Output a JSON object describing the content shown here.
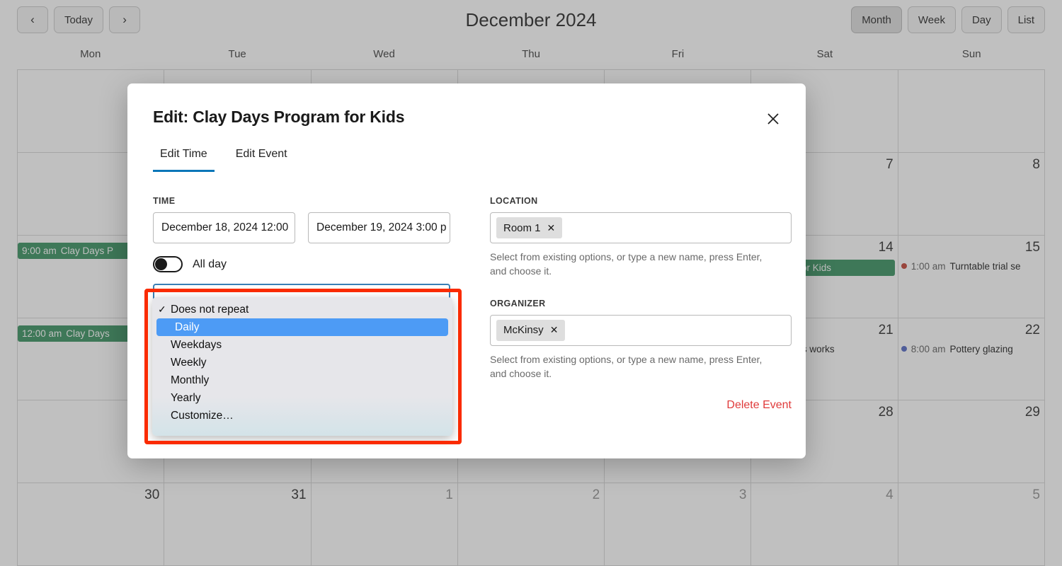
{
  "calendar": {
    "nav": {
      "prev_label": "‹",
      "today_label": "Today",
      "next_label": "›"
    },
    "title": "December 2024",
    "views": [
      {
        "label": "Month",
        "active": true
      },
      {
        "label": "Week",
        "active": false
      },
      {
        "label": "Day",
        "active": false
      },
      {
        "label": "List",
        "active": false
      }
    ],
    "day_headers": [
      "Mon",
      "Tue",
      "Wed",
      "Thu",
      "Fri",
      "Sat",
      "Sun"
    ],
    "weeks": [
      {
        "days": [
          {
            "num": "",
            "muted": false,
            "events": []
          },
          {
            "num": "",
            "muted": false,
            "events": []
          },
          {
            "num": "",
            "muted": false,
            "events": []
          },
          {
            "num": "",
            "muted": false,
            "events": []
          },
          {
            "num": "",
            "muted": false,
            "events": []
          },
          {
            "num": "",
            "muted": false,
            "events": []
          },
          {
            "num": "",
            "muted": false,
            "events": []
          }
        ]
      },
      {
        "days": [
          {
            "num": "",
            "muted": false,
            "events": []
          },
          {
            "num": "",
            "muted": false,
            "events": []
          },
          {
            "num": "",
            "muted": false,
            "events": []
          },
          {
            "num": "",
            "muted": false,
            "events": []
          },
          {
            "num": "",
            "muted": false,
            "events": []
          },
          {
            "num": "7",
            "muted": false,
            "events": []
          },
          {
            "num": "8",
            "muted": false,
            "events": []
          }
        ]
      },
      {
        "days": [
          {
            "num": "",
            "muted": false,
            "events": [
              {
                "style": "block",
                "time": "9:00 am",
                "name": "Clay Days P"
              }
            ]
          },
          {
            "num": "",
            "muted": false,
            "events": []
          },
          {
            "num": "",
            "muted": false,
            "events": []
          },
          {
            "num": "",
            "muted": false,
            "events": []
          },
          {
            "num": "",
            "muted": false,
            "events": []
          },
          {
            "num": "14",
            "muted": false,
            "events": [
              {
                "style": "bleed",
                "time": "",
                "name": "Clay Days Program for Kids"
              }
            ]
          },
          {
            "num": "15",
            "muted": false,
            "events": [
              {
                "style": "dot",
                "dot_color": "#c0392b",
                "time": "1:00 am",
                "name": "Turntable trial se"
              }
            ]
          }
        ]
      },
      {
        "days": [
          {
            "num": "",
            "muted": false,
            "events": [
              {
                "style": "block",
                "time": "12:00 am",
                "name": "Clay Days "
              }
            ]
          },
          {
            "num": "",
            "muted": false,
            "events": []
          },
          {
            "num": "",
            "muted": false,
            "events": []
          },
          {
            "num": "",
            "muted": false,
            "events": []
          },
          {
            "num": "",
            "muted": false,
            "events": []
          },
          {
            "num": "21",
            "muted": false,
            "events": [
              {
                "style": "plain",
                "time": "m",
                "name": "Ceramics works"
              }
            ]
          },
          {
            "num": "22",
            "muted": false,
            "events": [
              {
                "style": "dot",
                "dot_color": "#4a5fc1",
                "time": "8:00 am",
                "name": "Pottery glazing"
              }
            ]
          }
        ]
      },
      {
        "days": [
          {
            "num": "",
            "muted": false,
            "events": []
          },
          {
            "num": "",
            "muted": false,
            "events": []
          },
          {
            "num": "",
            "muted": false,
            "events": []
          },
          {
            "num": "",
            "muted": false,
            "events": []
          },
          {
            "num": "",
            "muted": false,
            "events": []
          },
          {
            "num": "28",
            "muted": false,
            "events": []
          },
          {
            "num": "29",
            "muted": false,
            "events": []
          }
        ]
      },
      {
        "days": [
          {
            "num": "30",
            "muted": false,
            "events": []
          },
          {
            "num": "31",
            "muted": false,
            "events": []
          },
          {
            "num": "1",
            "muted": true,
            "events": []
          },
          {
            "num": "2",
            "muted": true,
            "events": []
          },
          {
            "num": "3",
            "muted": true,
            "events": []
          },
          {
            "num": "4",
            "muted": true,
            "events": []
          },
          {
            "num": "5",
            "muted": true,
            "events": []
          }
        ]
      }
    ]
  },
  "modal": {
    "title": "Edit: Clay Days Program for Kids",
    "close_icon": "close-icon",
    "tabs": [
      {
        "label": "Edit Time",
        "active": true
      },
      {
        "label": "Edit Event",
        "active": false
      }
    ],
    "time": {
      "label": "TIME",
      "start_value": "December 18, 2024 12:00 ",
      "end_value": "December 19, 2024 3:00 p",
      "all_day_label": "All day",
      "all_day_on": false
    },
    "repeat": {
      "selected": "Does not repeat",
      "highlighted": "Daily",
      "options": [
        {
          "label": "Does not repeat",
          "checked": true,
          "highlighted": false
        },
        {
          "label": "Daily",
          "checked": false,
          "highlighted": true
        },
        {
          "label": "Weekdays",
          "checked": false,
          "highlighted": false
        },
        {
          "label": "Weekly",
          "checked": false,
          "highlighted": false
        },
        {
          "label": "Monthly",
          "checked": false,
          "highlighted": false
        },
        {
          "label": "Yearly",
          "checked": false,
          "highlighted": false
        },
        {
          "label": "Customize…",
          "checked": false,
          "highlighted": false
        }
      ],
      "check_glyph": "✓"
    },
    "location": {
      "label": "LOCATION",
      "tag": "Room 1",
      "remove_glyph": "✕",
      "hint": "Select from existing options, or type a new name, press Enter, and choose it."
    },
    "organizer": {
      "label": "ORGANIZER",
      "tag": "McKinsy",
      "remove_glyph": "✕",
      "hint": "Select from existing options, or type a new name, press Enter, and choose it."
    },
    "delete_label": "Delete Event"
  },
  "colors": {
    "accent": "#0a76b8",
    "event_green": "#2e8b57",
    "danger": "#e03b3b",
    "highlight_blue": "#4d9bf5",
    "annotation_red": "#fa2b00"
  }
}
